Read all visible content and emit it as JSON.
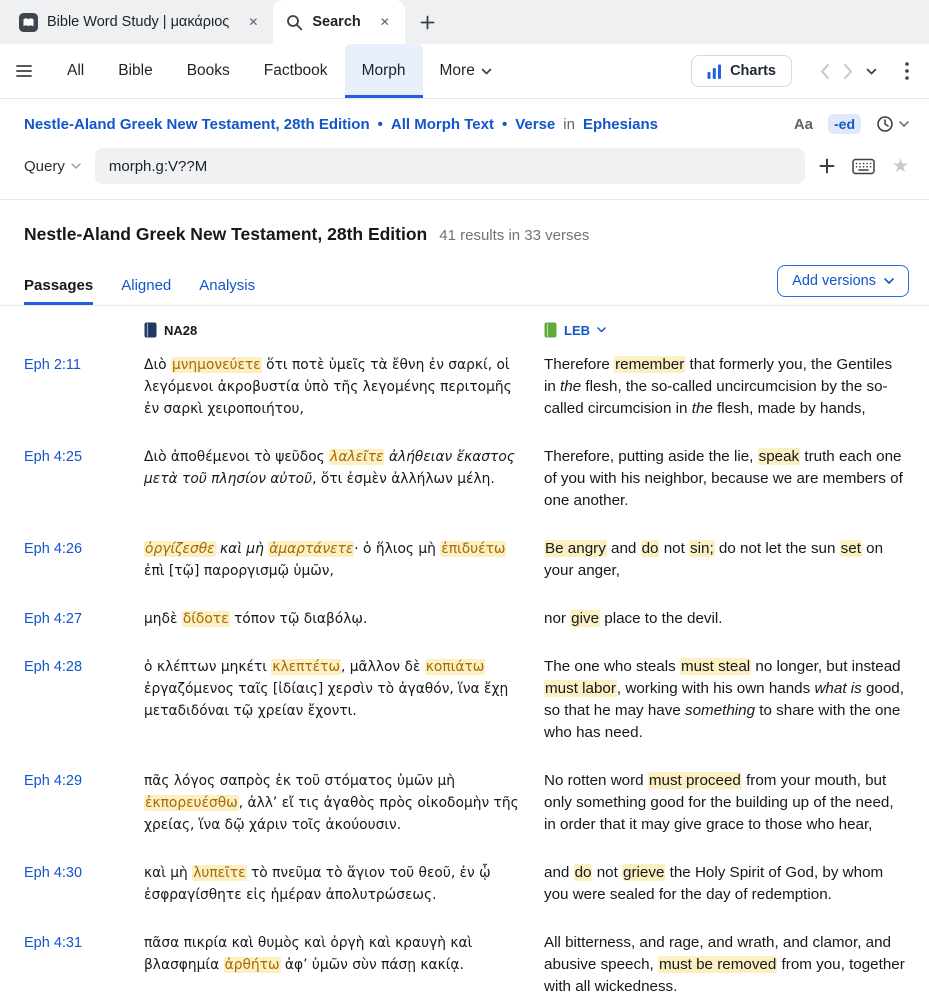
{
  "window": {
    "tabs": [
      {
        "label": "Bible Word Study | μακάριος",
        "icon": "bible-word-study-icon",
        "active": false
      },
      {
        "label": "Search",
        "icon": "search-icon",
        "active": true
      }
    ]
  },
  "toolbar": {
    "tabs": [
      "All",
      "Bible",
      "Books",
      "Factbook",
      "Morph",
      "More"
    ],
    "active_tab": "Morph",
    "charts_label": "Charts"
  },
  "scope": {
    "resource": "Nestle-Aland Greek New Testament, 28th Edition",
    "separator": "•",
    "morph_text": "All Morph Text",
    "unit": "Verse",
    "in_label": "in",
    "book": "Ephesians",
    "case_label": "Aa",
    "forms_label": "-ed"
  },
  "query": {
    "label": "Query",
    "value": "morph.g:V??M"
  },
  "results": {
    "title": "Nestle-Aland Greek New Testament, 28th Edition",
    "summary": "41 results in 33 verses",
    "tabs": [
      "Passages",
      "Aligned",
      "Analysis"
    ],
    "active_tab": "Passages",
    "add_versions": "Add versions",
    "columns": [
      {
        "label": "NA28",
        "icon_color": "#1e3a63"
      },
      {
        "label": "LEB",
        "icon_color": "#62a83c"
      }
    ],
    "rows": [
      {
        "ref": "Eph 2:11",
        "greek": [
          {
            "t": "Διὸ "
          },
          {
            "t": "μνημονεύετε",
            "h": true
          },
          {
            "t": " ὅτι ποτὲ ὑμεῖς τὰ ἔθνη ἐν σαρκί, οἱ λεγόμενοι ἀκροβυστία ὑπὸ τῆς λεγομένης περιτομῆς ἐν σαρκὶ χειροποιήτου,"
          }
        ],
        "english": [
          {
            "t": "Therefore "
          },
          {
            "t": "remember",
            "h": true
          },
          {
            "t": " that formerly you, the Gentiles in "
          },
          {
            "t": "the",
            "i": true
          },
          {
            "t": " flesh, the so-called uncircumcision by the so-called circumcision in "
          },
          {
            "t": "the",
            "i": true
          },
          {
            "t": " flesh, made by hands,"
          }
        ]
      },
      {
        "ref": "Eph 4:25",
        "greek": [
          {
            "t": "Διὸ ἀποθέμενοι τὸ ψεῦδος "
          },
          {
            "t": "λαλεῖτε",
            "h": true,
            "i": true
          },
          {
            "t": " ἀλήθειαν ἕκαστος μετὰ τοῦ πλησίον αὐτοῦ",
            "i": true
          },
          {
            "t": ", ὅτι ἐσμὲν ἀλλήλων μέλη."
          }
        ],
        "english": [
          {
            "t": "Therefore, putting aside the lie, "
          },
          {
            "t": "speak",
            "h": true
          },
          {
            "t": " truth each one of you with his neighbor, because we are members of one another."
          }
        ]
      },
      {
        "ref": "Eph 4:26",
        "greek": [
          {
            "t": "ὀργίζεσθε",
            "h": true,
            "i": true
          },
          {
            "t": " καὶ μὴ ",
            "i": true
          },
          {
            "t": "ἁμαρτάνετε",
            "h": true,
            "i": true
          },
          {
            "t": "· ὁ ἥλιος μὴ "
          },
          {
            "t": "ἐπιδυέτω",
            "h": true
          },
          {
            "t": " ἐπὶ [τῷ] παροργισμῷ ὑμῶν,"
          }
        ],
        "english": [
          {
            "t": "Be angry",
            "h": true
          },
          {
            "t": " and "
          },
          {
            "t": "do",
            "h": true
          },
          {
            "t": " not "
          },
          {
            "t": "sin;",
            "h": true
          },
          {
            "t": " do not let the sun "
          },
          {
            "t": "set",
            "h": true
          },
          {
            "t": " on your anger,"
          }
        ]
      },
      {
        "ref": "Eph 4:27",
        "greek": [
          {
            "t": "μηδὲ "
          },
          {
            "t": "δίδοτε",
            "h": true
          },
          {
            "t": " τόπον τῷ διαβόλῳ."
          }
        ],
        "english": [
          {
            "t": "nor "
          },
          {
            "t": "give",
            "h": true
          },
          {
            "t": " place to the devil."
          }
        ]
      },
      {
        "ref": "Eph 4:28",
        "greek": [
          {
            "t": "ὁ κλέπτων μηκέτι "
          },
          {
            "t": "κλεπτέτω",
            "h": true
          },
          {
            "t": ", μᾶλλον δὲ "
          },
          {
            "t": "κοπιάτω",
            "h": true
          },
          {
            "t": " ἐργαζόμενος ταῖς [ἰδίαις] χερσὶν τὸ ἀγαθόν, ἵνα ἔχῃ μεταδιδόναι τῷ χρείαν ἔχοντι."
          }
        ],
        "english": [
          {
            "t": "The one who steals "
          },
          {
            "t": "must steal",
            "h": true
          },
          {
            "t": " no longer, but instead "
          },
          {
            "t": "must labor",
            "h": true
          },
          {
            "t": ", working with his own hands "
          },
          {
            "t": "what is",
            "i": true
          },
          {
            "t": " good, so that he may have "
          },
          {
            "t": "something",
            "i": true
          },
          {
            "t": " to share with the one who has need."
          }
        ]
      },
      {
        "ref": "Eph 4:29",
        "greek": [
          {
            "t": "πᾶς λόγος σαπρὸς ἐκ τοῦ στόματος ὑμῶν μὴ "
          },
          {
            "t": "ἐκπορευέσθω",
            "h": true
          },
          {
            "t": ", ἀλλ’ εἴ τις ἀγαθὸς πρὸς οἰκοδομὴν τῆς χρείας, ἵνα δῷ χάριν τοῖς ἀκούουσιν."
          }
        ],
        "english": [
          {
            "t": "No rotten word "
          },
          {
            "t": "must proceed",
            "h": true
          },
          {
            "t": " from your mouth, but only something good for the building up of the need, in order that it may give grace to those who hear,"
          }
        ]
      },
      {
        "ref": "Eph 4:30",
        "greek": [
          {
            "t": "καὶ μὴ "
          },
          {
            "t": "λυπεῖτε",
            "h": true
          },
          {
            "t": " τὸ πνεῦμα τὸ ἅγιον τοῦ θεοῦ, ἐν ᾧ ἐσφραγίσθητε εἰς ἡμέραν ἀπολυτρώσεως."
          }
        ],
        "english": [
          {
            "t": "and "
          },
          {
            "t": "do",
            "h": true
          },
          {
            "t": " not "
          },
          {
            "t": "grieve",
            "h": true
          },
          {
            "t": " the Holy Spirit of God, by whom you were sealed for the day of redemption."
          }
        ]
      },
      {
        "ref": "Eph 4:31",
        "greek": [
          {
            "t": "πᾶσα πικρία καὶ θυμὸς καὶ ὀργὴ καὶ κραυγὴ καὶ βλασφημία "
          },
          {
            "t": "ἀρθήτω",
            "h": true
          },
          {
            "t": " ἀφ’ ὑμῶν σὺν πάσῃ κακίᾳ."
          }
        ],
        "english": [
          {
            "t": "All bitterness, and rage, and wrath, and clamor, and abusive speech, "
          },
          {
            "t": "must be removed",
            "h": true
          },
          {
            "t": " from you, together with all wickedness."
          }
        ]
      }
    ]
  },
  "colors": {
    "accent_blue": "#1256c9",
    "active_underline": "#2161de",
    "hit_background": "#fcf0c2",
    "greek_hit_text": "#a5690a",
    "tabbar_background": "#eef0f2"
  }
}
